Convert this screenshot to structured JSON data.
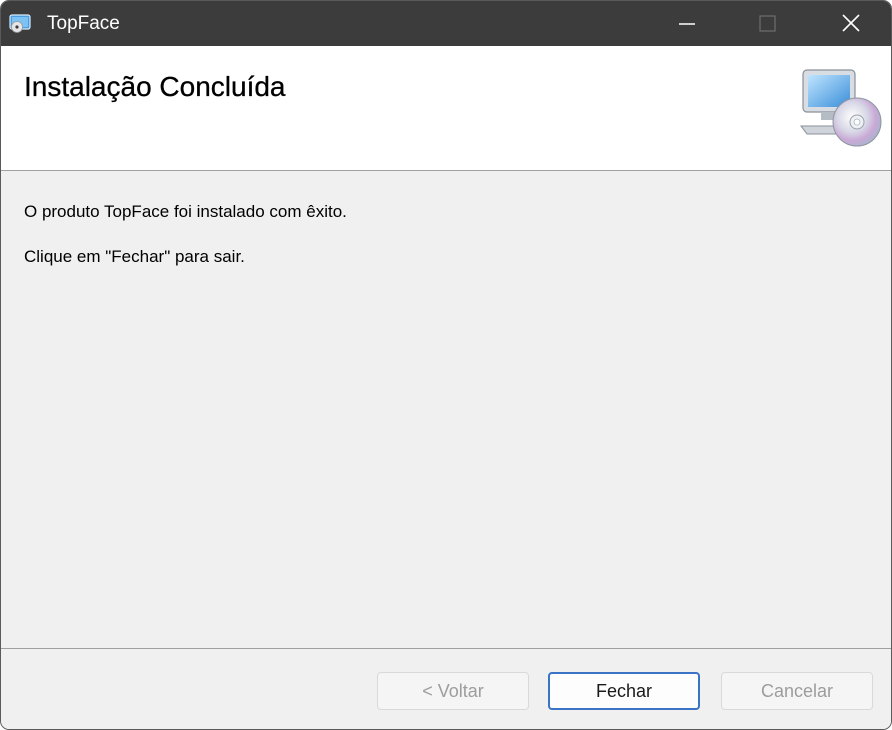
{
  "window": {
    "title": "TopFace"
  },
  "header": {
    "title": "Instalação Concluída",
    "icon": "computer-cd-icon"
  },
  "content": {
    "message1": "O produto TopFace foi instalado com êxito.",
    "message2": "Clique em \"Fechar\" para sair."
  },
  "footer": {
    "back_label": "< Voltar",
    "close_label": "Fechar",
    "cancel_label": "Cancelar"
  },
  "colors": {
    "titlebar": "#3c3c3c",
    "accent": "#3b73c5",
    "background": "#f0f0f0"
  }
}
